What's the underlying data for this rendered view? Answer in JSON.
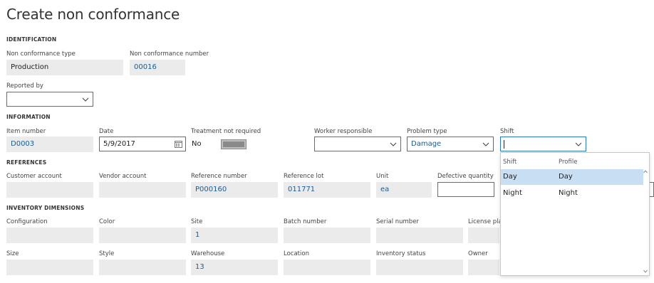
{
  "page": {
    "title": "Create non conformance"
  },
  "identification": {
    "heading": "IDENTIFICATION",
    "nc_type_label": "Non conformance type",
    "nc_type_value": "Production",
    "nc_number_label": "Non conformance number",
    "nc_number_value": "00016",
    "reported_by_label": "Reported by",
    "reported_by_value": ""
  },
  "information": {
    "heading": "INFORMATION",
    "item_number_label": "Item number",
    "item_number_value": "D0003",
    "date_label": "Date",
    "date_value": "5/9/2017",
    "treatment_label": "Treatment not required",
    "treatment_value": "No",
    "worker_label": "Worker responsible",
    "worker_value": "",
    "problem_type_label": "Problem type",
    "problem_type_value": "Damage",
    "shift_label": "Shift",
    "shift_value": ""
  },
  "references": {
    "heading": "REFERENCES",
    "customer_account_label": "Customer account",
    "customer_account_value": "",
    "vendor_account_label": "Vendor account",
    "vendor_account_value": "",
    "reference_number_label": "Reference number",
    "reference_number_value": "P000160",
    "reference_lot_label": "Reference lot",
    "reference_lot_value": "011771",
    "unit_label": "Unit",
    "unit_value": "ea",
    "defective_quantity_label": "Defective quantity",
    "defective_quantity_value": ""
  },
  "inventory": {
    "heading": "INVENTORY DIMENSIONS",
    "configuration_label": "Configuration",
    "color_label": "Color",
    "site_label": "Site",
    "site_value": "1",
    "batch_label": "Batch number",
    "serial_label": "Serial number",
    "license_label": "License pla",
    "size_label": "Size",
    "style_label": "Style",
    "warehouse_label": "Warehouse",
    "warehouse_value": "13",
    "location_label": "Location",
    "inventory_status_label": "Inventory status",
    "owner_label": "Owner"
  },
  "shift_dropdown": {
    "col_shift": "Shift",
    "col_profile": "Profile",
    "rows": [
      {
        "shift": "Day",
        "profile": "Day",
        "selected": true
      },
      {
        "shift": "Night",
        "profile": "Night",
        "selected": false
      }
    ]
  },
  "icons": {
    "dropdown": "chevron-down-icon",
    "calendar": "calendar-icon"
  },
  "colors": {
    "link_value": "#1a5d94",
    "focus_border": "#2b79c2",
    "selected_row": "#c7def3",
    "field_bg": "#ebebeb"
  }
}
